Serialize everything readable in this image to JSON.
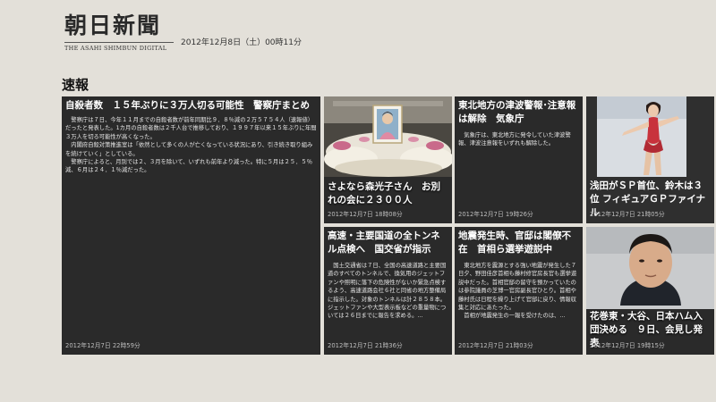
{
  "masthead": {
    "logo": "朝日新聞",
    "subtitle": "THE ASAHI SHIMBUN DIGITAL",
    "datetime": "2012年12月8日（土）00時11分"
  },
  "section": {
    "title": "速報"
  },
  "tiles": [
    {
      "headline": "自殺者数　１５年ぶりに３万人切る可能性　警察庁まとめ",
      "paragraphs": [
        "警察庁は７日、今年１１月までの自殺者数が前年同期比９．８％減の２万５７５４人（速報値）だったと発表した。1カ月の自殺者数は２千人台で推移しており、１９９７年以来１５年ぶりに年間３万人を切る可能性が高くなった。",
        "内閣府自殺対策推進室は「依然として多くの人が亡くなっている状況にあり、引き続き取り組みを続けていく」としている。",
        "警察庁によると、月別では２、３月を除いて、いずれも前年より減った。特に５月は２５．５％減、６月は２４．１％減だった。"
      ],
      "timestamp": "2012年12月7日 22時59分"
    },
    {
      "headline": "さよなら森光子さん　お別れの会に２３００人",
      "timestamp": "2012年12月7日 18時08分"
    },
    {
      "headline": "東北地方の津波警報･注意報は解除　気象庁",
      "paragraphs": [
        "気象庁は、東北地方に発令していた津波警報、津波注意報をいずれも解除した。"
      ],
      "timestamp": "2012年12月7日 19時26分"
    },
    {
      "headline": "浅田がＳＰ首位、鈴木は３位 フィギュアＧＰファイナル",
      "timestamp": "2012年12月7日 21時05分"
    },
    {
      "headline": "高速・主要国道の全トンネル点検へ　国交省が指示",
      "paragraphs": [
        "国土交通省は７日、全国の高速道路と主要国道のすべてのトンネルで、換気用のジェットファンや照明に落下の危険性がないか緊急点検するよう、高速道路会社６社と同省の地方整備局に指示した。対象のトンネルは計２８５８本。ジェットファンや大型表示板などの重量物については２６日までに報告を求める。…"
      ],
      "timestamp": "2012年12月7日 21時36分"
    },
    {
      "headline": "地震発生時、官邸は閣僚不在　首相ら選挙遊説中",
      "paragraphs": [
        "東北地方を震源とする強い地震が発生した７日夕、野田佳彦首相も藤村修官房長官も選挙遊説中だった。首相官邸の留守を預かっていたのは参院議員の芝博一官房副長官ひとり。首相や藤村氏は日程を繰り上げて官邸に戻り、情報収集と対応にあたった。",
        "首相が地震発生の一報を受けたのは、…"
      ],
      "timestamp": "2012年12月7日 21時03分"
    },
    {
      "headline": "花巻東・大谷、日本ハム入団決める　９日、会見し発表",
      "timestamp": "2012年12月7日 19時15分"
    }
  ],
  "colors": {
    "background": "#e3e0d9",
    "tile": "#2a2a2a",
    "text": "#ffffff"
  }
}
